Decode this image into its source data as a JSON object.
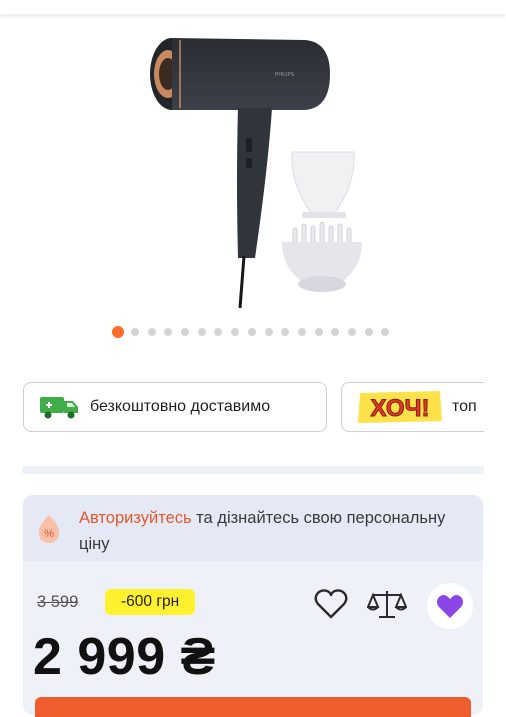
{
  "gallery": {
    "product_brand": "PHILIPS",
    "dots_total": 17,
    "active_dot": 0,
    "accent_color": "#ff6d2d"
  },
  "badges": [
    {
      "icon": "truck-icon",
      "label": "безкоштовно доставимо"
    },
    {
      "icon": "hoch-logo",
      "logo_text": "ХОЧ!",
      "label": "топ"
    }
  ],
  "login_banner": {
    "link_text": "Авторизуйтесь",
    "text": " та дізнайтесь свою персональну ціну"
  },
  "price": {
    "old": "3 599",
    "discount": "-600 грн",
    "current": "2 999 ₴"
  },
  "actions": {
    "wishlist_icon": "heart-icon",
    "compare_icon": "scales-icon",
    "gift_icon": "purple-heart-icon"
  },
  "colors": {
    "accent": "#ff6d2d",
    "discount_bg": "#fff12d",
    "card_bg": "#eef1f8",
    "link": "#e6582a"
  }
}
